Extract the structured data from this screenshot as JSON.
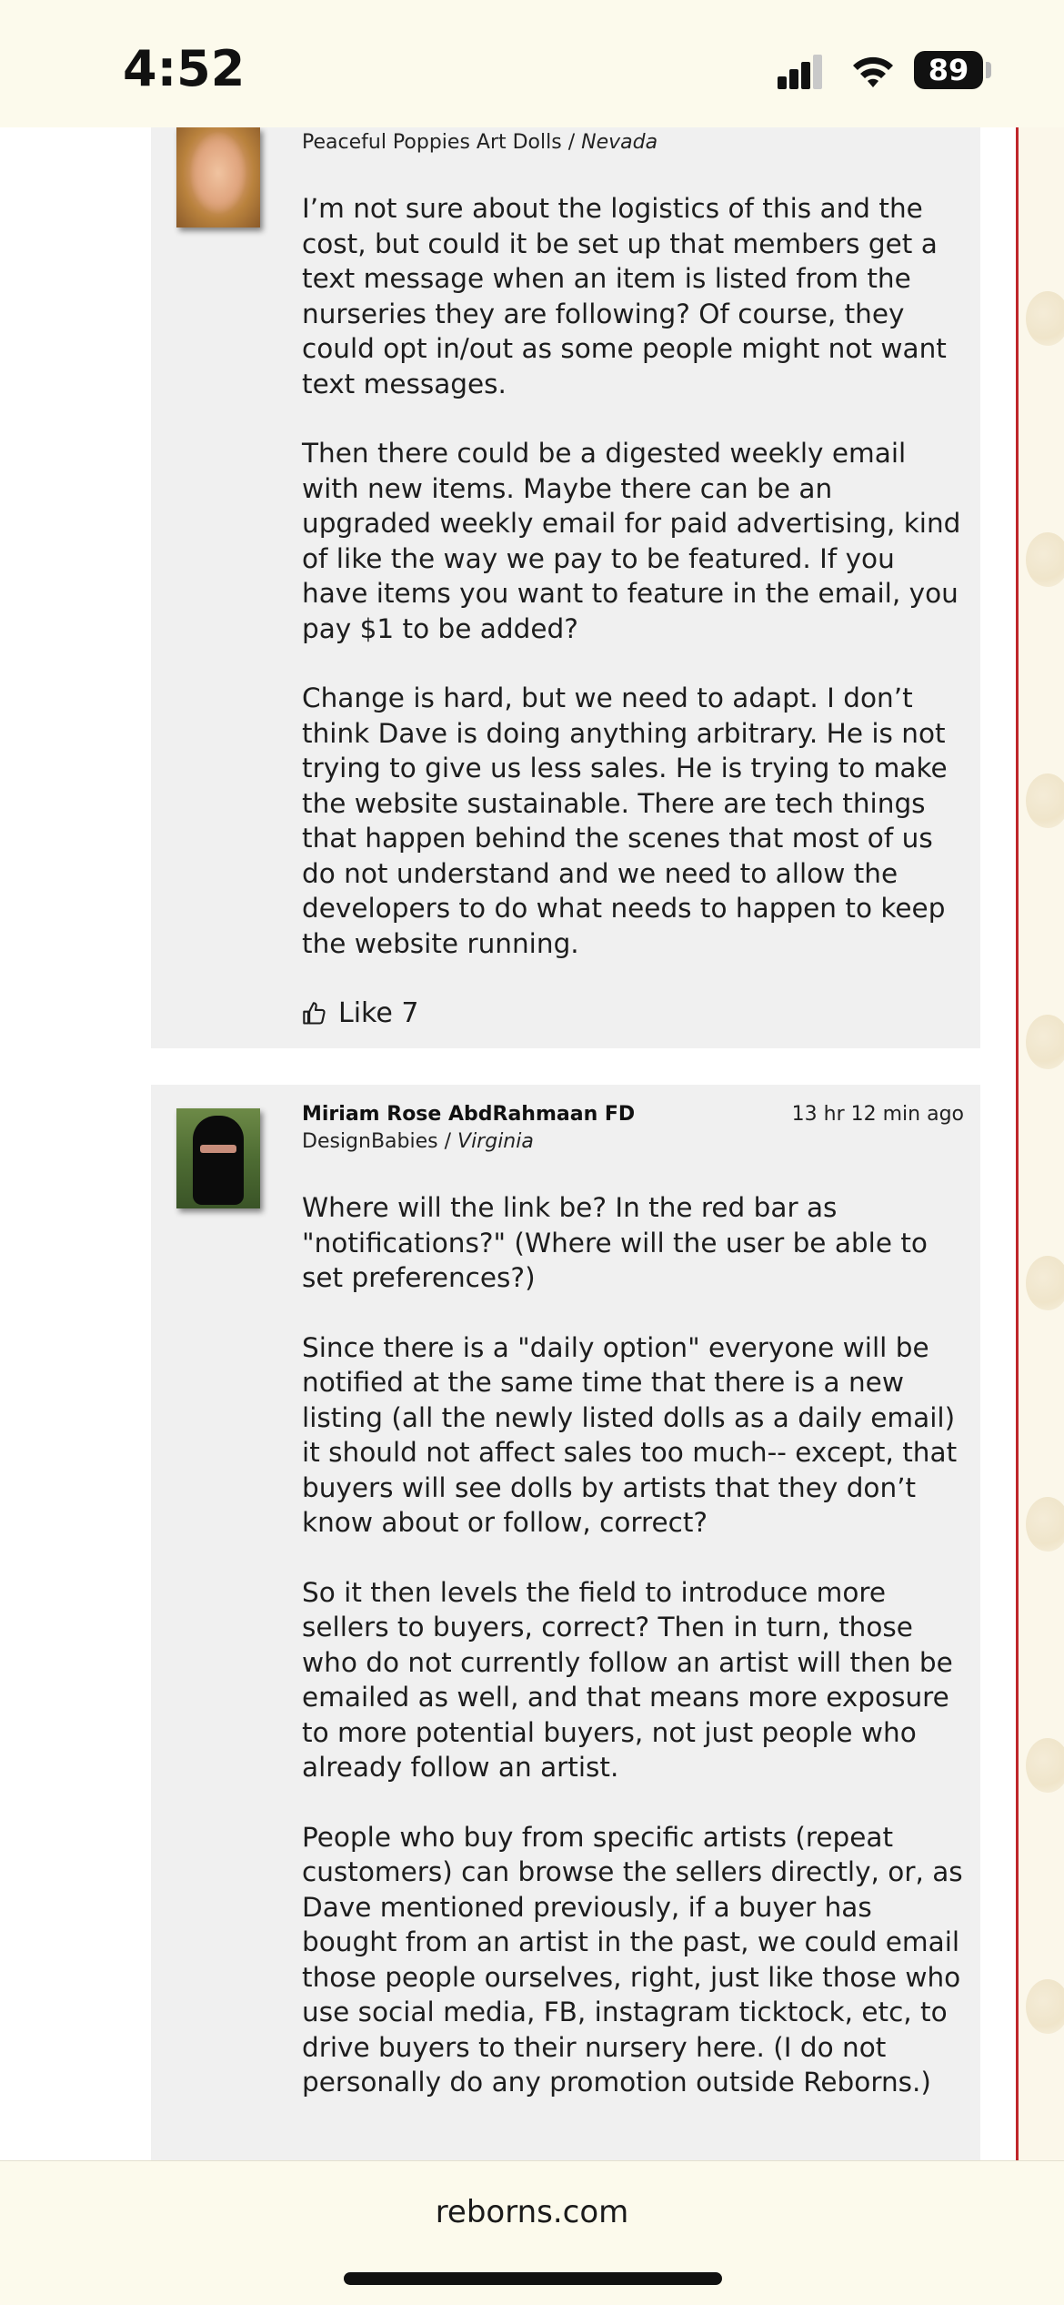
{
  "status_bar": {
    "time": "4:52",
    "battery": "89"
  },
  "comments": [
    {
      "author": "",
      "time_ago": "",
      "nursery": "Peaceful Poppies Art Dolls",
      "location": "Nevada",
      "paragraphs": [
        "I’m not sure about the logistics of this and the cost, but could it be set up that members get a text message when an item is listed from the nurseries they are following? Of course, they could opt in/out as some people might not want text messages.",
        "Then there could be a digested weekly email with new items. Maybe there can be an upgraded weekly email for paid advertising, kind of like the way we pay to be featured. If you have items you want to feature in the email, you pay $1 to be added?",
        "Change is hard, but we need to adapt. I don’t think Dave is doing anything arbitrary. He is not trying to give us less sales. He is trying to make the website sustainable. There are tech things that happen behind the scenes that most of us do not understand and we need to allow the developers to do what needs to happen to keep the website running."
      ],
      "like_label": "Like 7"
    },
    {
      "author": "Miriam Rose AbdRahmaan FD",
      "time_ago": "13 hr 12 min ago",
      "nursery": "DesignBabies",
      "location": "Virginia",
      "paragraphs": [
        "Where will the link be? In the red bar as \"notifications?\" (Where will the user be able to set preferences?)",
        "Since there is a \"daily option\" everyone will be notified at the same time that there is a new listing (all the newly listed dolls as a daily email) it should not affect sales too much-- except, that buyers will see dolls by artists that they don’t know about or follow, correct?",
        "So it then levels the field to introduce more sellers to buyers, correct? Then in turn, those who do not currently follow an artist will then be emailed as well, and that means more exposure to more potential buyers, not just people who already follow an artist.",
        "People who buy from specific artists (repeat customers) can browse the sellers directly, or, as Dave mentioned previously, if a buyer has bought from an artist in the past, we could email those people ourselves, right, just like those who use social media, FB, instagram ticktock, etc, to drive buyers to their nursery here. (I do not personally do any promotion outside Reborns.)"
      ]
    }
  ],
  "browser": {
    "url": "reborns.com"
  }
}
